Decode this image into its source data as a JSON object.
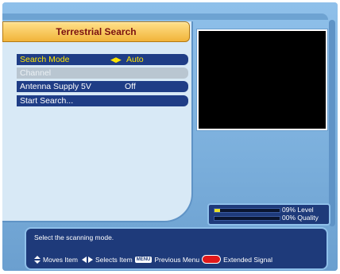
{
  "title": "Terrestrial Search",
  "menu": [
    {
      "label": "Search Mode",
      "arrows": "◀▶",
      "value": "Auto",
      "state": "active"
    },
    {
      "label": "Channel",
      "value": "",
      "state": "disabled"
    },
    {
      "label": "Antenna Supply 5V",
      "value": "Off",
      "state": "normal"
    },
    {
      "label": "Start Search...",
      "value": "",
      "state": "normal"
    }
  ],
  "signal": {
    "level_label": "09% Level",
    "quality_label": "00% Quality",
    "level_fraction": 0.09,
    "quality_fraction": 0.0,
    "bar_color": "#e8e02a"
  },
  "help": {
    "text": "Select the scanning mode.",
    "moves": "Moves Item",
    "selects": "Selects Item",
    "menu_key": "MENU",
    "previous": "Previous Menu",
    "extended": "Extended Signal"
  }
}
